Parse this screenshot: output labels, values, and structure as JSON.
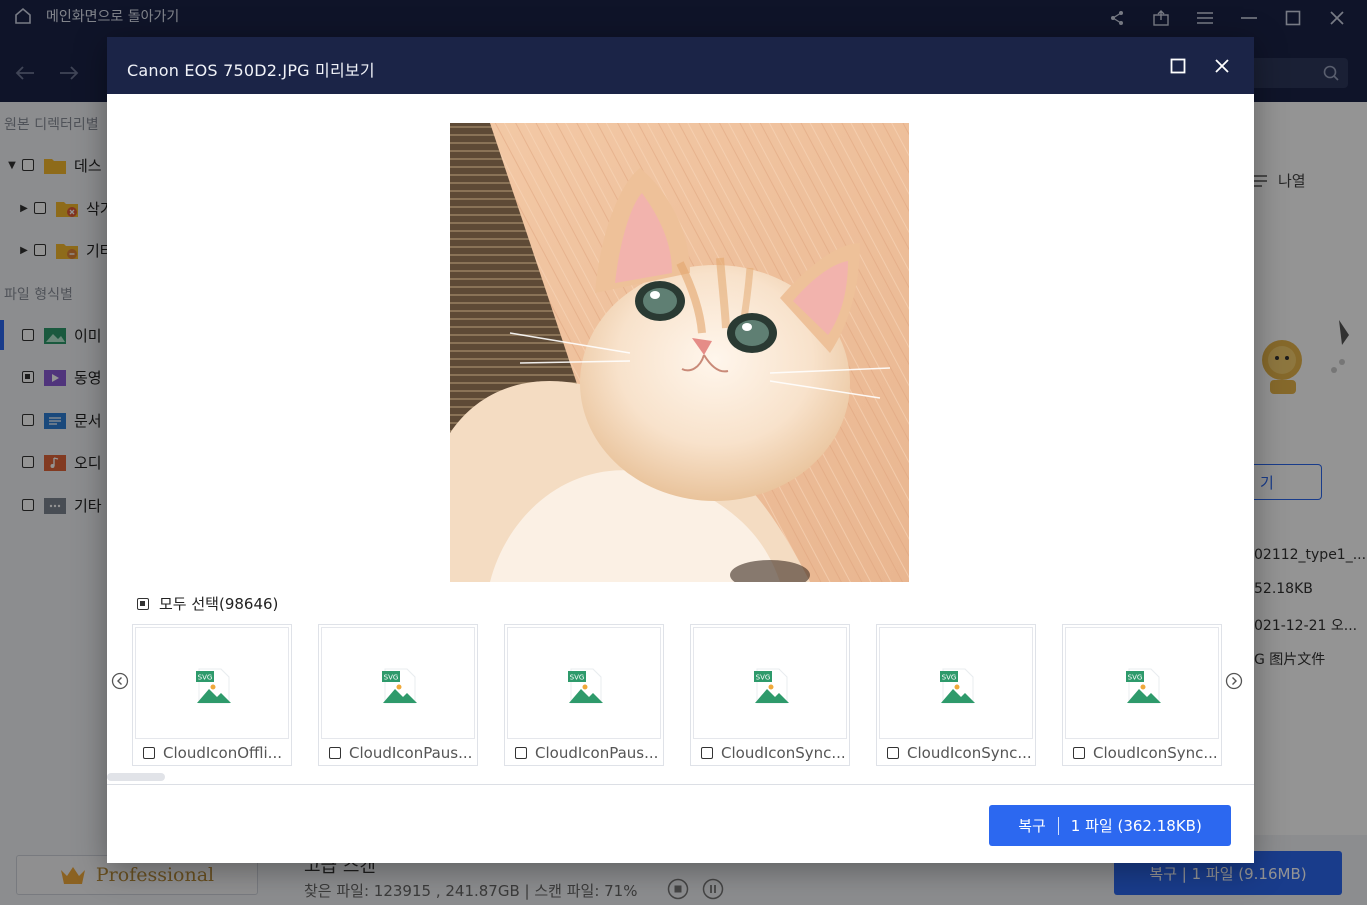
{
  "app": {
    "back_label": "메인화면으로 돌아가기"
  },
  "sidebar": {
    "source_label": "원본 디렉터리별",
    "filetype_label": "파일 형식별",
    "tree": [
      {
        "label": "데스"
      },
      {
        "label": "삭기"
      },
      {
        "label": "기타"
      }
    ],
    "types": [
      {
        "label": "이미"
      },
      {
        "label": "동영"
      },
      {
        "label": "문서"
      },
      {
        "label": "오디"
      },
      {
        "label": "기타"
      }
    ],
    "pro_label": "Professional"
  },
  "background": {
    "view_label": "나열",
    "open_label": "기",
    "meta": [
      "02112_type1_...",
      "52.18KB",
      "021-12-21 오...",
      "G 图片文件"
    ],
    "scan_title": "고급 스캔",
    "scan_status": "찾은 파일: 123915 , 241.87GB | 스캔 파일: 71%",
    "recover_label": "복구 | 1 파일 (9.16MB)"
  },
  "dialog": {
    "title": "Canon EOS 750D2.JPG 미리보기",
    "select_all_label": "모두 선택(98646)",
    "thumbnails": [
      {
        "name": "CloudIconOffli..."
      },
      {
        "name": "CloudIconPaus..."
      },
      {
        "name": "CloudIconPaus..."
      },
      {
        "name": "CloudIconSync..."
      },
      {
        "name": "CloudIconSync..."
      },
      {
        "name": "CloudIconSync..."
      }
    ],
    "recover_label": "복구",
    "recover_info": "1 파일 (362.18KB)",
    "badge": "SVG"
  },
  "colors": {
    "header_bg": "#1b2447",
    "accent": "#2c68f0",
    "file_icon_green": "#2e9a6b"
  }
}
